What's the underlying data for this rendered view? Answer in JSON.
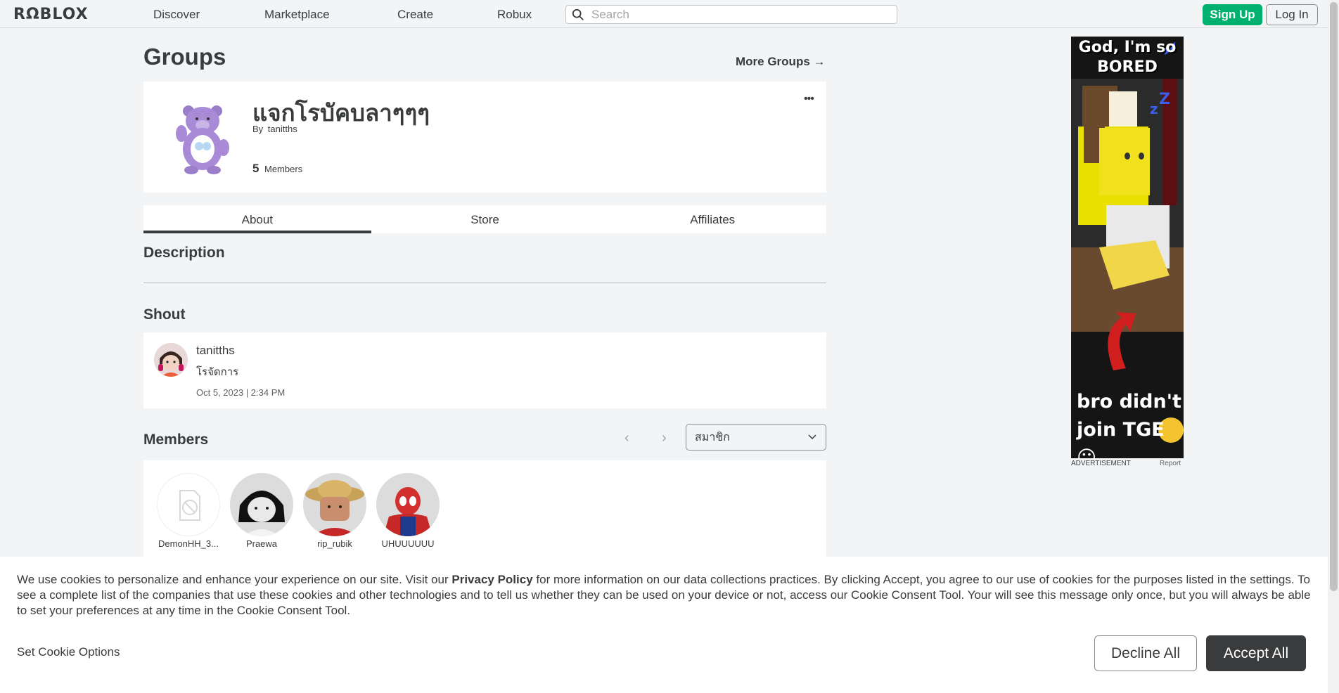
{
  "nav": {
    "logo": "RΩBLOX",
    "links": [
      "Discover",
      "Marketplace",
      "Create",
      "Robux"
    ],
    "search_placeholder": "Search",
    "signup": "Sign Up",
    "login": "Log In"
  },
  "page": {
    "title": "Groups",
    "more_groups": "More Groups →"
  },
  "group": {
    "name": "แจกโรบัคบลาๆๆๆ",
    "by_prefix": "By",
    "owner": "tanitths",
    "member_count": "5",
    "member_label": "Members",
    "more_menu": "•••"
  },
  "tabs": [
    "About",
    "Store",
    "Affiliates"
  ],
  "about": {
    "description_title": "Description",
    "shout_title": "Shout",
    "shout": {
      "user": "tanitths",
      "text": "โรจัดการ",
      "date": "Oct 5, 2023 | 2:34 PM"
    },
    "members_title": "Members",
    "role_select": "สมาชิก",
    "members": [
      {
        "name": "DemonHH_3..."
      },
      {
        "name": "Praewa"
      },
      {
        "name": "rip_rubik"
      },
      {
        "name": "UHUUUUUU"
      }
    ]
  },
  "ad": {
    "top_line1": "God, I'm so",
    "top_line2": "BORED",
    "bottom_line1": "bro didn't",
    "bottom_line2": "join TGE 😐",
    "label": "ADVERTISEMENT",
    "report": "Report"
  },
  "cookie": {
    "text_before": "We use cookies to personalize and enhance your experience on our site. Visit our ",
    "privacy_link": "Privacy Policy",
    "text_after": " for more information on our data collections practices. By clicking Accept, you agree to our use of cookies for the purposes listed in the settings. To see a complete list of the companies that use these cookies and other technologies and to tell us whether they can be used on your device or not, access our Cookie Consent Tool. Your will see this message only once, but you will always be able to set your preferences at any time in the Cookie Consent Tool.",
    "set_options": "Set Cookie Options",
    "decline": "Decline All",
    "accept": "Accept All"
  }
}
